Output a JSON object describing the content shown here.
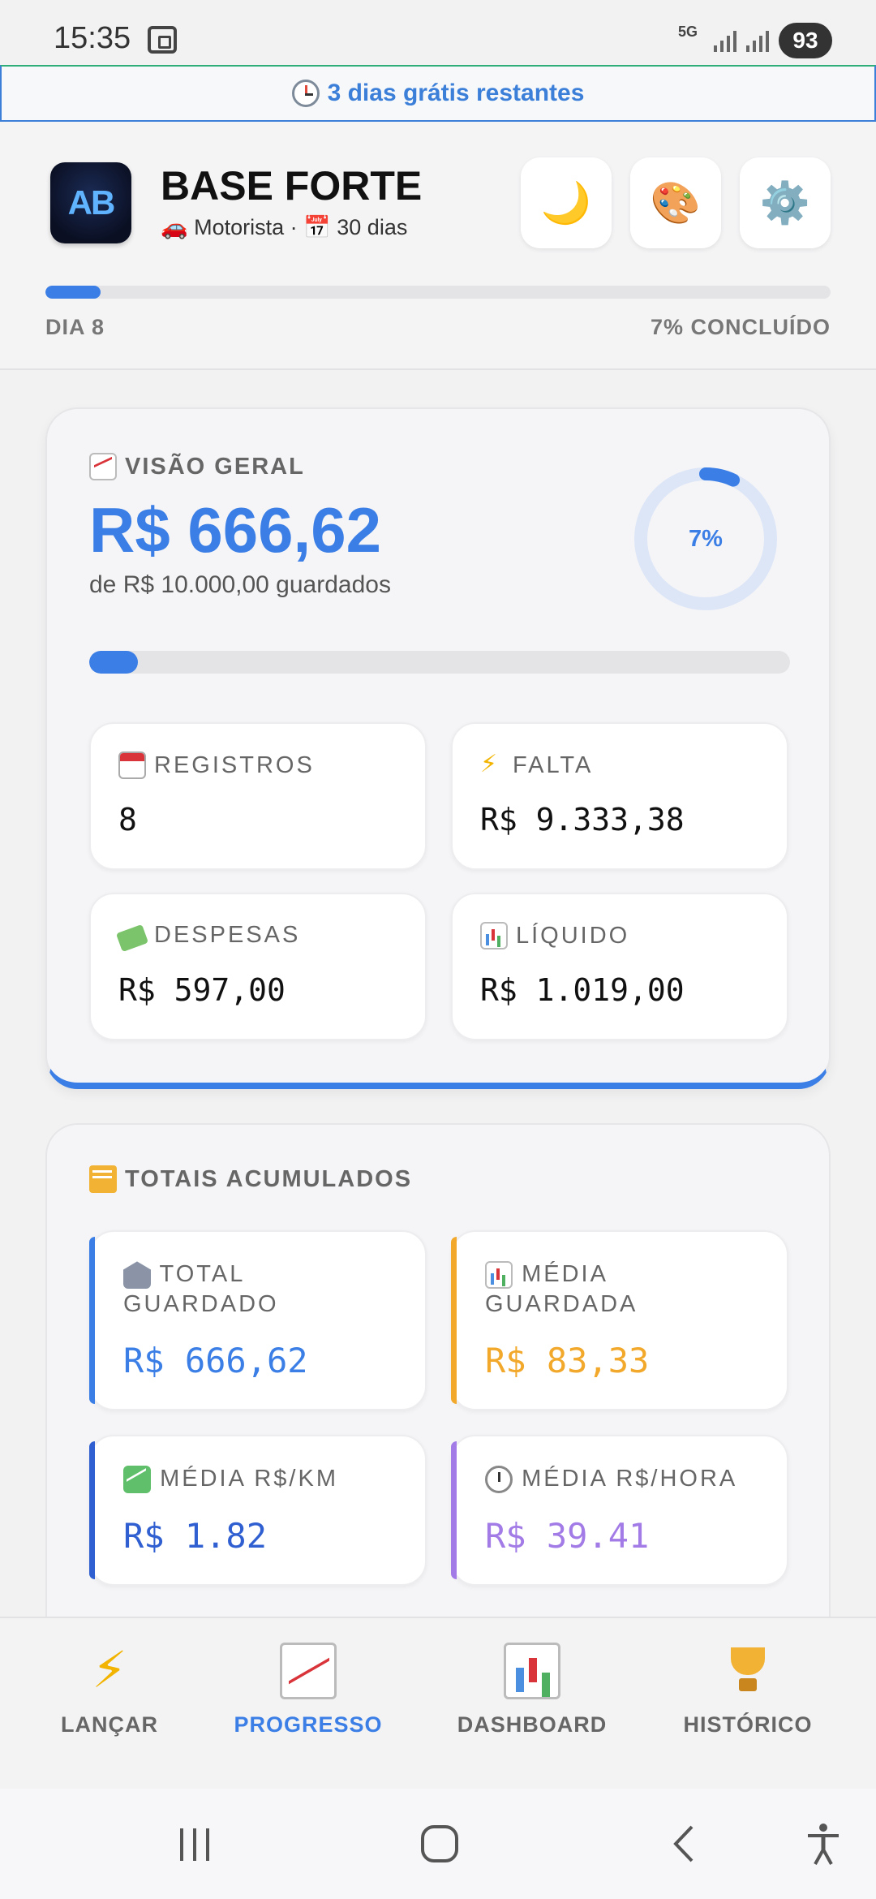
{
  "status_bar": {
    "time": "15:35",
    "network": "5G",
    "battery": "93",
    "icons": [
      "screenshot-icon",
      "signal-icon",
      "signal-icon",
      "battery-icon"
    ]
  },
  "trial_banner": {
    "icon": "clock-icon",
    "text": "3 dias grátis restantes"
  },
  "header": {
    "logo_text": "AB",
    "title": "BASE FORTE",
    "subtitle": "🚗 Motorista · 📅 30 dias",
    "buttons": [
      {
        "name": "dark-mode-button",
        "icon": "🌙"
      },
      {
        "name": "theme-button",
        "icon": "🎨"
      },
      {
        "name": "settings-button",
        "icon": "⚙️"
      }
    ],
    "progress": 0.07,
    "day_label": "DIA 8",
    "percent_label": "7% CONCLUÍDO"
  },
  "overview": {
    "title": "VISÃO GERAL",
    "amount": "R$ 666,62",
    "amount_sub": "de R$ 10.000,00 guardados",
    "ring_label": "7%",
    "progress": 0.07,
    "stats": [
      {
        "icon": "calendar-icon",
        "label": "REGISTROS",
        "value": "8"
      },
      {
        "icon": "lightning-icon",
        "label": "FALTA",
        "value": "R$ 9.333,38"
      },
      {
        "icon": "money-icon",
        "label": "DESPESAS",
        "value": "R$ 597,00"
      },
      {
        "icon": "bar-chart-icon",
        "label": "LÍQUIDO",
        "value": "R$ 1.019,00"
      }
    ]
  },
  "totals": {
    "title": "TOTAIS ACUMULADOS",
    "items": [
      {
        "icon": "bank-icon",
        "label": "TOTAL GUARDADO",
        "value": "R$ 666,62",
        "color": "#3b7fe6"
      },
      {
        "icon": "bar-chart-icon",
        "label": "MÉDIA GUARDADA",
        "value": "R$ 83,33",
        "color": "#f2a82b"
      },
      {
        "icon": "growth-chart-icon",
        "label": "MÉDIA R$/KM",
        "value": "R$ 1.82",
        "color": "#2f5fd0"
      },
      {
        "icon": "timer-icon",
        "label": "MÉDIA R$/HORA",
        "value": "R$ 39.41",
        "color": "#a27be6"
      }
    ]
  },
  "bottom_nav": [
    {
      "label": "LANÇAR",
      "icon": "lightning-icon",
      "active": false
    },
    {
      "label": "PROGRESSO",
      "icon": "line-chart-icon",
      "active": true
    },
    {
      "label": "DASHBOARD",
      "icon": "bar-chart-icon",
      "active": false
    },
    {
      "label": "HISTÓRICO",
      "icon": "trophy-icon",
      "active": false
    }
  ],
  "colors": {
    "accent": "#3b7fe6",
    "orange": "#f2a82b",
    "purple": "#a27be6",
    "dark_blue": "#2f5fd0"
  }
}
